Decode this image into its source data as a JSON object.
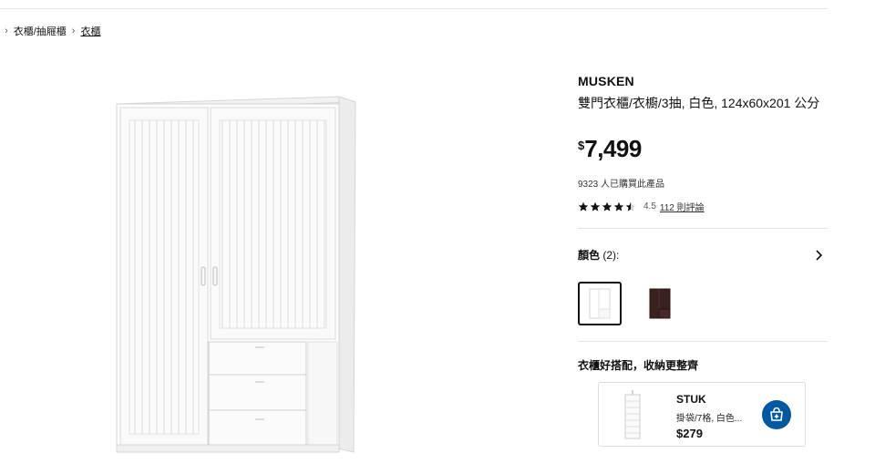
{
  "breadcrumb": {
    "items": [
      ",",
      "衣櫃/抽屜櫃",
      "衣櫃"
    ],
    "separator": "›"
  },
  "product": {
    "brand": "MUSKEN",
    "description": "雙門衣櫃/衣櫥/3抽, 白色, 124x60x201 公分",
    "currency_symbol": "$",
    "price": "7,499",
    "bought_count_text": "9323 人已購買此產品",
    "rating": {
      "stars": 4.5,
      "score": "4.5",
      "reviews_label": "112 則評論"
    }
  },
  "colors": {
    "label": "顏色",
    "count_text": "(2):",
    "options": [
      {
        "name": "white",
        "hex": "#ffffff",
        "selected": true
      },
      {
        "name": "brown",
        "hex": "#3b2020",
        "selected": false
      }
    ]
  },
  "recommendations": {
    "title": "衣櫃好搭配，收納更整齊",
    "items": [
      {
        "name": "STUK",
        "desc": "掛袋/7格, 白色...",
        "price": "$279",
        "icon": "add-to-bag-icon"
      }
    ]
  },
  "theme": {
    "accent": "#0058a3",
    "star_color": "#111111"
  }
}
